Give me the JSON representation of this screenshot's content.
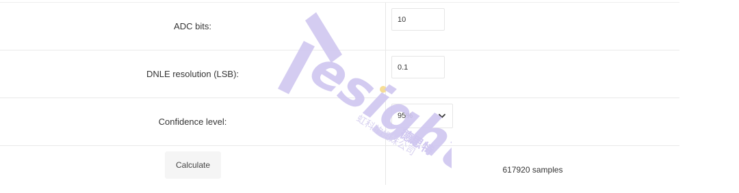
{
  "form": {
    "adc_bits": {
      "label": "ADC bits:",
      "value": "10"
    },
    "dnle_resolution": {
      "label": "DNLE resolution (LSB):",
      "value": "0.1"
    },
    "confidence_level": {
      "label": "Confidence level:",
      "selected": "95%"
    },
    "calculate_label": "Calculate",
    "result": "617920 samples"
  },
  "watermark": {
    "logo_text": "esight",
    "cn_brand": "德思特",
    "cn_subtitle": "虹科的姐妹公司"
  },
  "icons": {
    "select_arrow": "chevron-down-icon"
  },
  "colors": {
    "watermark_purple": "#cfc6f0",
    "watermark_dot": "#f5d98a",
    "button_bg": "#f5f5f5"
  }
}
